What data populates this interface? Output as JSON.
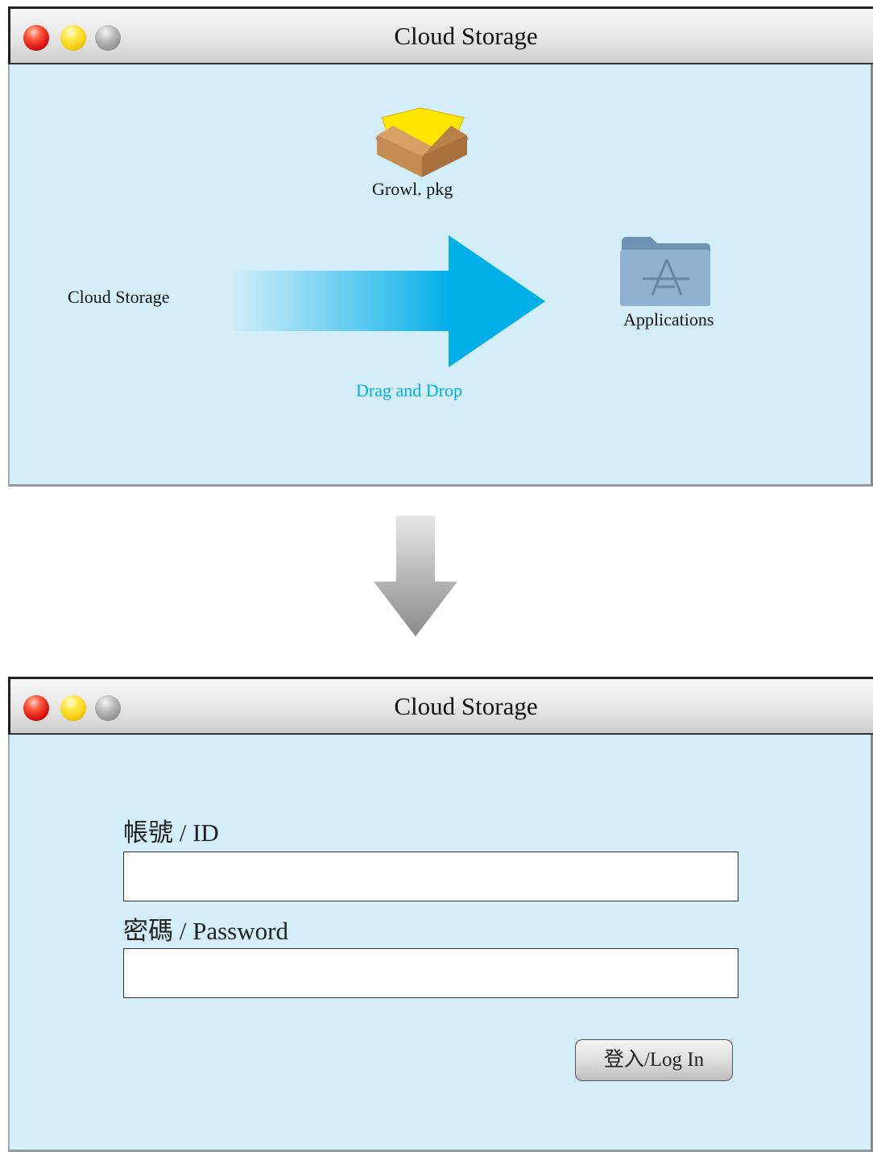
{
  "installer": {
    "title": "Cloud Storage",
    "package_label": "Growl. pkg",
    "source_label": "Cloud Storage",
    "target_label": "Applications",
    "instruction": "Drag and Drop",
    "accent_color": "#00aee8"
  },
  "login": {
    "title": "Cloud Storage",
    "id_label": "帳號 / ID",
    "id_value": "",
    "password_label": "密碼 / Password",
    "password_value": "",
    "login_button": "登入/Log In"
  },
  "icons": [
    "close-icon",
    "minimize-icon",
    "zoom-icon",
    "package-box-icon",
    "applications-folder-icon",
    "drag-arrow-icon",
    "flow-down-arrow-icon"
  ]
}
